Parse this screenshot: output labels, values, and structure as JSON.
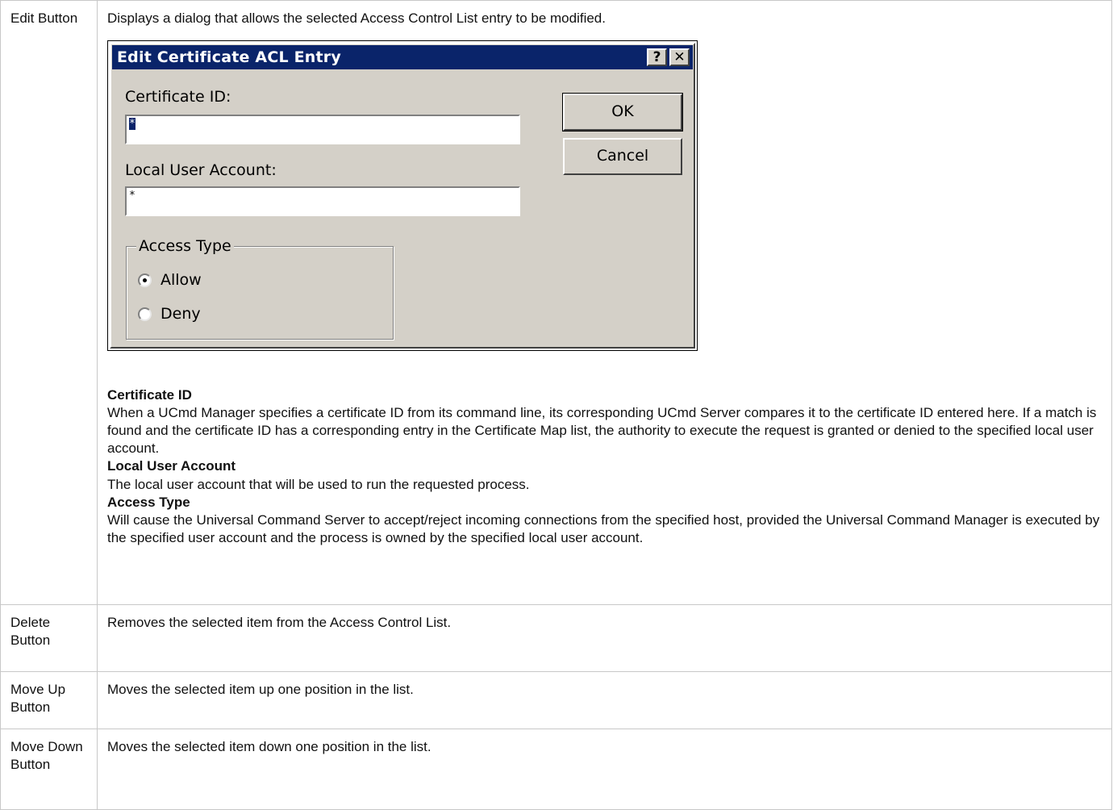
{
  "rows": [
    {
      "term": "Edit Button",
      "description": "Displays a dialog that allows the selected Access Control List entry to be modified."
    },
    {
      "term": "Delete Button",
      "description": "Removes the selected item from the Access Control List."
    },
    {
      "term": "Move Up Button",
      "description": "Moves the selected item up one position in the list."
    },
    {
      "term": "Move Down Button",
      "description": "Moves the selected item down one position in the list."
    }
  ],
  "dialog": {
    "title": "Edit Certificate ACL Entry",
    "help_label": "?",
    "close_label": "✕",
    "certificate_id_label": "Certificate ID:",
    "certificate_id_value": "*",
    "local_user_label": "Local User Account:",
    "local_user_value": "*",
    "ok_label": "OK",
    "cancel_label": "Cancel",
    "access_type_label": "Access Type",
    "allow_label": "Allow",
    "deny_label": "Deny",
    "selected_access": "Allow"
  },
  "sections": [
    {
      "title": "Certificate ID",
      "body": "When a UCmd Manager specifies a certificate ID from its command line, its corresponding UCmd Server compares it to the certificate ID entered here. If a match is found and the certificate ID has a corresponding entry in the Certificate Map list, the authority to execute the request is granted or denied to the specified local user account."
    },
    {
      "title": "Local User Account",
      "body": "The local user account that will be used to run the requested process."
    },
    {
      "title": "Access Type",
      "body": "Will cause the Universal Command Server to accept/reject incoming connections from the specified host, provided the Universal Command Manager is executed by the specified user account and the process is owned by the specified local user account."
    }
  ]
}
